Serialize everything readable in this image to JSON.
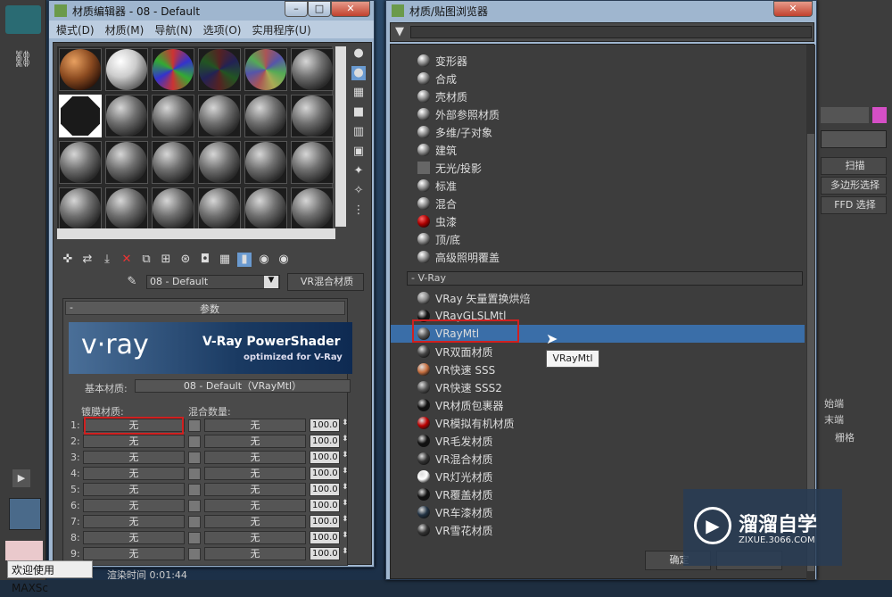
{
  "material_editor": {
    "title": "材质编辑器 - 08 - Default",
    "menu": [
      "模式(D)",
      "材质(M)",
      "导航(N)",
      "选项(O)",
      "实用程序(U)"
    ],
    "material_name": "08 - Default",
    "material_type_button": "VR混合材质",
    "rollout_title": "参数",
    "rollout_collapse": "-",
    "banner_brand": "v·ray",
    "banner_title": "V-Ray PowerShader",
    "banner_subtitle": "optimized for V-Ray",
    "base_material_label": "基本材质:",
    "base_material_value": "08 - Default（VRayMtl）",
    "coat_label": "镀膜材质:",
    "blend_label": "混合数量:",
    "none_label": "无",
    "rows": [
      {
        "num": "1:",
        "value": "100.0"
      },
      {
        "num": "2:",
        "value": "100.0"
      },
      {
        "num": "3:",
        "value": "100.0"
      },
      {
        "num": "4:",
        "value": "100.0"
      },
      {
        "num": "5:",
        "value": "100.0"
      },
      {
        "num": "6:",
        "value": "100.0"
      },
      {
        "num": "7:",
        "value": "100.0"
      },
      {
        "num": "8:",
        "value": "100.0"
      },
      {
        "num": "9:",
        "value": "100.0"
      }
    ],
    "status_text": "渲染时间 0:01:44"
  },
  "browser": {
    "title": "材质/贴图浏览器",
    "std_items": [
      "变形器",
      "合成",
      "壳材质",
      "外部参照材质",
      "多维/子对象",
      "建筑",
      "无光/投影",
      "标准",
      "混合",
      "虫漆",
      "顶/底",
      "高级照明覆盖"
    ],
    "vray_section": "- V-Ray",
    "vray_items": [
      "VRay 矢量置换烘焙",
      "VRayGLSLMtl",
      "VRayMtl",
      "VR双面材质",
      "VR快速 SSS",
      "VR快速 SSS2",
      "VR材质包裹器",
      "VR模拟有机材质",
      "VR毛发材质",
      "VR混合材质",
      "VR灯光材质",
      "VR覆盖材质",
      "VR车漆材质",
      "VR雪花材质"
    ],
    "tooltip": "VRayMtl",
    "ok_button": "确定"
  },
  "background_app": {
    "scan_btn": "扫描",
    "poly_btn": "多边形选择",
    "ffd_btn": "FFD 选择",
    "text1": "始端",
    "text2": "末端",
    "text3": "栅格"
  },
  "taskbar": {
    "welcome": "欢迎使用 MAXSc"
  },
  "watermark": {
    "brand": "溜溜自学",
    "url": "ZIXUE.3066.COM"
  }
}
